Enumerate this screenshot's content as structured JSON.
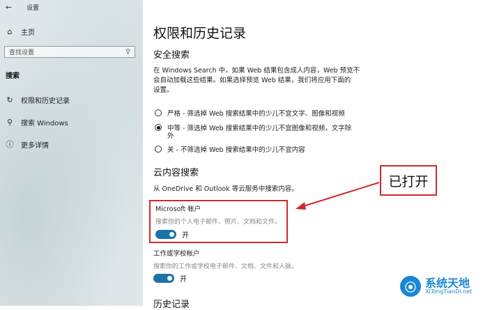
{
  "sidebar": {
    "back": "←",
    "app_title": "设置",
    "home": "主页",
    "search_placeholder": "查找设置",
    "category": "搜索",
    "items": [
      {
        "label": "权限和历史记录",
        "icon": "history-icon"
      },
      {
        "label": "搜索 Windows",
        "icon": "search-icon"
      },
      {
        "label": "更多详情",
        "icon": "info-icon"
      }
    ]
  },
  "main": {
    "title": "权限和历史记录",
    "safe_search": {
      "heading": "安全搜索",
      "desc_line1": "在 Windows Search 中，如果 Web 结果包含成人内容，Web 预览不",
      "desc_line2": "会自动加载这些结果。如果选择预览 Web 结果，我们将应用下面的",
      "desc_line3": "设置。",
      "options": [
        {
          "label": "严格 - 筛选掉 Web 搜索结果中的少儿不宜文字、图像和视频",
          "selected": false
        },
        {
          "label": "中等 - 筛选掉 Web 搜索结果中的少儿不宜图像和视频，文字除",
          "label2": "外",
          "selected": true
        },
        {
          "label": "关 - 不筛选掉 Web 搜索结果中的少儿不宜内容",
          "selected": false
        }
      ]
    },
    "cloud": {
      "heading": "云内容搜索",
      "desc": "从 OneDrive 和 Outlook 等云服务中搜索内容。",
      "microsoft": {
        "title": "Microsoft 帐户",
        "desc": "搜索你的个人电子邮件、照片、文档和文件。",
        "state": "开"
      },
      "work": {
        "title": "工作或学校帐户",
        "desc": "搜索你的工作或学校电子邮件、文档、文件和人脉。",
        "state": "开"
      }
    },
    "history_heading": "历史记录"
  },
  "annotation": {
    "callout": "已打开",
    "color": "#cf2a2a"
  },
  "watermark": {
    "cn": "系统天地",
    "en": "XiTongTianDi.net"
  }
}
